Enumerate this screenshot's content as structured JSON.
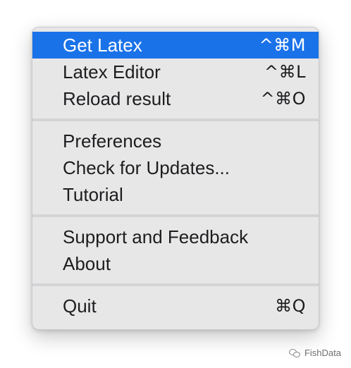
{
  "menu": {
    "groups": [
      [
        {
          "label": "Get Latex",
          "shortcut": "^⌘M"
        },
        {
          "label": "Latex Editor",
          "shortcut": "^⌘L"
        },
        {
          "label": "Reload result",
          "shortcut": "^⌘O"
        }
      ],
      [
        {
          "label": "Preferences",
          "shortcut": ""
        },
        {
          "label": "Check for Updates...",
          "shortcut": ""
        },
        {
          "label": "Tutorial",
          "shortcut": ""
        }
      ],
      [
        {
          "label": "Support and Feedback",
          "shortcut": ""
        },
        {
          "label": "About",
          "shortcut": ""
        }
      ],
      [
        {
          "label": "Quit",
          "shortcut": "⌘Q"
        }
      ]
    ],
    "highlight_color": "#1a72e8"
  },
  "watermark": {
    "text": "FishData",
    "icon": "wechat-icon"
  }
}
